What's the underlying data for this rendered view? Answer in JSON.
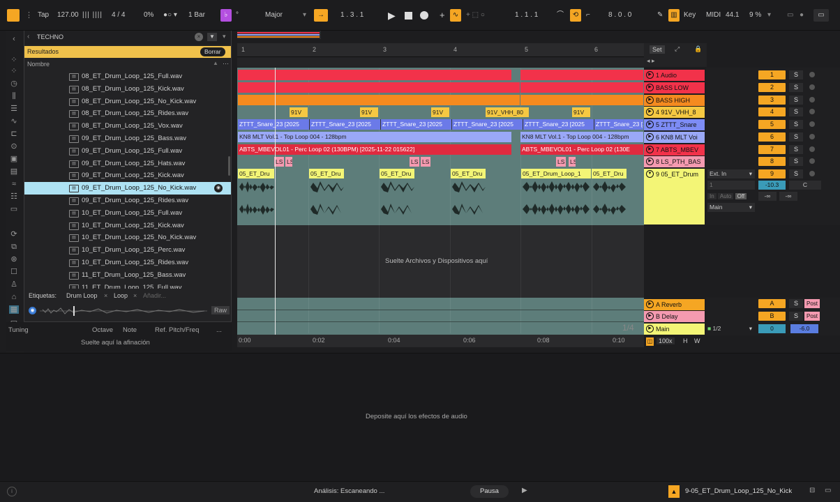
{
  "transport": {
    "tap": "Tap",
    "tempo": "127.00",
    "signature": "4 / 4",
    "swing": "0%",
    "quantize": "1 Bar",
    "scale_key": "°",
    "scale_mode": "Major",
    "position": "1 .  3 .  1",
    "loop_start": "1 .  1 .  1",
    "loop_length": "8 .  0 .  0",
    "key_label": "Key",
    "midi_label": "MIDI",
    "sample_rate": "44.1",
    "cpu": "9 %"
  },
  "browser": {
    "title": "TECHNO",
    "results_label": "Resultados",
    "clear_label": "Borrar",
    "column_name": "Nombre",
    "files": [
      "08_ET_Drum_Loop_125_Full.wav",
      "08_ET_Drum_Loop_125_Kick.wav",
      "08_ET_Drum_Loop_125_No_Kick.wav",
      "08_ET_Drum_Loop_125_Rides.wav",
      "08_ET_Drum_Loop_125_Vox.wav",
      "09_ET_Drum_Loop_125_Bass.wav",
      "09_ET_Drum_Loop_125_Full.wav",
      "09_ET_Drum_Loop_125_Hats.wav",
      "09_ET_Drum_Loop_125_Kick.wav",
      "09_ET_Drum_Loop_125_No_Kick.wav",
      "09_ET_Drum_Loop_125_Rides.wav",
      "10_ET_Drum_Loop_125_Full.wav",
      "10_ET_Drum_Loop_125_Kick.wav",
      "10_ET_Drum_Loop_125_No_Kick.wav",
      "10_ET_Drum_Loop_125_Perc.wav",
      "10_ET_Drum_Loop_125_Rides.wav",
      "11_ET_Drum_Loop_125_Bass.wav",
      "11_ET_Drum_Loop_125_Full.wav"
    ],
    "selected_index": 9,
    "tags_label": "Etiquetas:",
    "tag1": "Drum Loop",
    "tag2": "Loop",
    "tag_add": "Añadir...",
    "raw_label": "Raw"
  },
  "tuning": {
    "title": "Tuning",
    "octave": "Octave",
    "note": "Note",
    "ref": "Ref. Pitch/Freq",
    "more": "...",
    "drop_hint": "Suelte aquí la afinación"
  },
  "arrangement": {
    "bars": [
      "1",
      "2",
      "3",
      "4",
      "5",
      "6"
    ],
    "times": [
      "0:00",
      "0:02",
      "0:04",
      "0:06",
      "0:08",
      "0:10"
    ],
    "set_label": "Set",
    "drop_hint": "Suelte Archivos y Dispositivos aquí",
    "page_indicator": "1/4",
    "clips": {
      "zttt": "ZTTT_Snare_23 [2025",
      "kn8a": "KN8 MLT Vol.1 - Top Loop 004 - 128bpm",
      "kn8b": "KN8 MLT Vol.1 - Top Loop 004 - 128bpm",
      "abtsa": "ABTS_MBEVOL01 - Perc Loop 02 (130BPM) [2025-11-22 015622]",
      "abtsb": "ABTS_MBEVOL01 - Perc Loop 02 (130E",
      "v91": "91V",
      "v91hh": "91V_VHH_80",
      "ls": "LS",
      "drum": "05_ET_Dru",
      "drumlong": "05_ET_Drum_Loop_1"
    },
    "tracks": [
      {
        "name": "1 Audio",
        "num": "1",
        "color": "#f2324a"
      },
      {
        "name": "BASS LOW",
        "num": "2",
        "color": "#f2324a"
      },
      {
        "name": "BASS HIGH",
        "num": "3",
        "color": "#f58a1f"
      },
      {
        "name": "4 91V_VHH_8",
        "num": "4",
        "color": "#f5c842"
      },
      {
        "name": "5 ZTTT_Snare",
        "num": "5",
        "color": "#7d8cf5"
      },
      {
        "name": "6 KN8 MLT Voi",
        "num": "6",
        "color": "#9aa8f7"
      },
      {
        "name": "7 ABTS_MBEV",
        "num": "7",
        "color": "#f2324a"
      },
      {
        "name": "8 LS_PTH_BAS",
        "num": "8",
        "color": "#f59ab0"
      },
      {
        "name": "9 05_ET_Drum",
        "num": "9",
        "color": "#f3f576"
      }
    ],
    "returns": [
      {
        "name": "A Reverb",
        "num": "A",
        "color": "#f5a623"
      },
      {
        "name": "B Delay",
        "num": "B",
        "color": "#f59ab0"
      }
    ],
    "master": {
      "name": "Main",
      "ratio": "1/2",
      "vol": "0",
      "db": "-6.0"
    },
    "io": {
      "in": "Ext. In",
      "ch": "1",
      "mon_in": "In",
      "mon_auto": "Auto",
      "mon_off": "Off",
      "out": "Main",
      "vol": "-10.3",
      "pan": "C",
      "inf1": "-∞",
      "inf2": "-∞"
    },
    "post": "Post",
    "s_label": "S",
    "zoom": "100x",
    "h": "H",
    "w": "W"
  },
  "bottom": {
    "drop_hint": "Deposite aquí los efectos de audio"
  },
  "status": {
    "analysis": "Análisis: Escaneando ...",
    "pause": "Pausa",
    "current": "9-05_ET_Drum_Loop_125_No_Kick"
  }
}
